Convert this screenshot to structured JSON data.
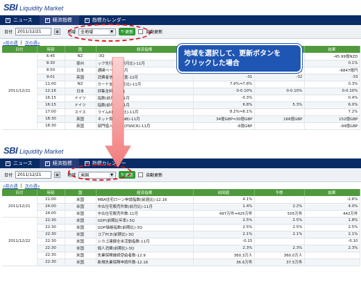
{
  "brand": {
    "sbi": "SBI",
    "name": "Liquidity Market"
  },
  "nav": {
    "tabs": [
      {
        "label": "ニュース",
        "icon": "plus-icon"
      },
      {
        "label": "経済指標",
        "icon": "plus-icon",
        "active": true
      },
      {
        "label": "指標カレンダー",
        "icon": "plus-icon"
      }
    ]
  },
  "filter_top": {
    "date_label": "日付",
    "date_value": "2011/12/21",
    "region_label": "地域",
    "region_value": "全地域",
    "update_label": "更新",
    "auto_update_label": "自動更新"
  },
  "filter_bottom": {
    "date_label": "日付",
    "date_value": "2011/12/21",
    "region_label": "地域",
    "region_value": "米国",
    "update_label": "更新",
    "auto_update_label": "自動更新"
  },
  "pager": {
    "prev": "前の週",
    "next": "次の週"
  },
  "callout": {
    "line1": "地域を選択して、更新ボタンを",
    "line2": "クリックした場合"
  },
  "table_top": {
    "headers": [
      "日付",
      "時刻",
      "国",
      "経済指標",
      "",
      "",
      "結果"
    ],
    "date": "2011/12/21",
    "rows": [
      [
        "6:45",
        "NZ",
        "-3Q",
        "",
        "",
        "-45.99億NZD"
      ],
      [
        "8:30",
        "豪州",
        "ック先行指数(前月比)-11月",
        "",
        "",
        "0.1%"
      ],
      [
        "8:50",
        "日本",
        "通関ベース)-11月",
        "-2738億円⇒-2802億円",
        "-4847億円",
        "-6847億円"
      ],
      [
        "9:01",
        "英国",
        "消費者信頼感調査-12月",
        "-31",
        "-32",
        "-33"
      ],
      [
        "11:00",
        "NZ",
        "カード支出(前月比)-11月",
        "7.9%⇒7.8%",
        "",
        "0.3%"
      ],
      [
        "12:16",
        "日本",
        "評集全料-12-21",
        "0-0.10%",
        "0-0.10%",
        "0-0.10%"
      ],
      [
        "16:15",
        "ドイツ",
        "指数(前月比)-11月",
        "-0.3%",
        "",
        "0.4%"
      ],
      [
        "16:15",
        "ドイツ",
        "指数(前年比)-11月",
        "6.8%",
        "5.3%",
        "6.0%"
      ],
      [
        "17:00",
        "スイス",
        "ライムKK(前年比)-11月",
        "8.2%⇒8.1%",
        "",
        "7.2%"
      ],
      [
        "18:30",
        "英国",
        "ネット負債(PSNB)-11月",
        "34億GBP⇒30億GBP",
        "166億GBP",
        "152億GBP"
      ],
      [
        "18:30",
        "英国",
        "部門借入所要額(PSNCR)-11月",
        "-6億GBP",
        "",
        "-94億GBP"
      ]
    ]
  },
  "table_bottom": {
    "headers": [
      "日付",
      "時刻",
      "国",
      "経済指標",
      "前回値",
      "予想",
      "結果"
    ],
    "date_1": "2011/12/21",
    "date_2": "2011/12/22",
    "rows": [
      [
        "21:00",
        "米国",
        "MBA住宅ローン申請指数(前週比)-12.16",
        "4.1%",
        "",
        "-2.6%"
      ],
      [
        "24:00",
        "米国",
        "中古住宅販売件数(前月比)-11月",
        "1.4%",
        "2.2%",
        "4.0%"
      ],
      [
        "24:00",
        "米国",
        "中古住宅販売件数-11月",
        "497万件⇒425万件",
        "505万件",
        "442万件"
      ],
      [
        "22:30",
        "米国",
        "GDP(前期比年率)-3Q",
        "2.5%",
        "2.5%",
        "1.8%"
      ],
      [
        "22:30",
        "米国",
        "GDP価格指数(前期比)-3Q",
        "2.5%",
        "2.5%",
        "2.5%"
      ],
      [
        "22:30",
        "米国",
        "コアPCE(前期比)-3Q",
        "2.1%",
        "2.1%",
        "2.1%"
      ],
      [
        "22:30",
        "米国",
        "シカゴ連銀全米活動指数-11月",
        "-0.15",
        "",
        "-0.10"
      ],
      [
        "22:30",
        "米国",
        "個人消費(前期比)-3Q",
        "2.3%",
        "2.3%",
        "2.3%"
      ],
      [
        "22:30",
        "米国",
        "失業保険継続受給者数-12.9",
        "360.3万人",
        "360.0万人",
        ""
      ],
      [
        "22:30",
        "米国",
        "新規失業保険申請件数-12.16",
        "36.6万件",
        "37.5万件",
        ""
      ]
    ]
  },
  "colors": {
    "nav": "#0a2c66",
    "table_header": "#4f9a3c",
    "callout": "#1f56b4",
    "highlight": "#e0141c",
    "arrow": "#f5a0a0"
  }
}
